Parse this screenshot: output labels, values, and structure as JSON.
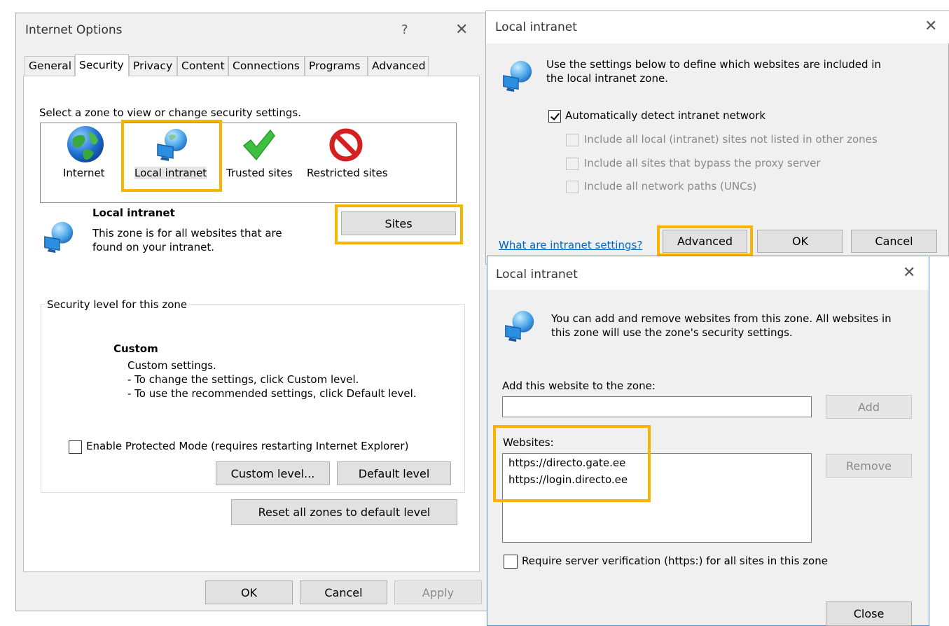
{
  "internet_options": {
    "title": "Internet Options",
    "help_glyph": "?",
    "close_glyph": "✕",
    "tabs": [
      "General",
      "Security",
      "Privacy",
      "Content",
      "Connections",
      "Programs",
      "Advanced"
    ],
    "active_tab": "Security",
    "zone_prompt": "Select a zone to view or change security settings.",
    "zones": [
      {
        "label": "Internet",
        "icon": "globe-icon"
      },
      {
        "label": "Local intranet",
        "icon": "intranet-icon",
        "selected": true
      },
      {
        "label": "Trusted sites",
        "icon": "checkmark-icon"
      },
      {
        "label": "Restricted sites",
        "icon": "restricted-icon"
      }
    ],
    "zone_title": "Local intranet",
    "zone_desc_line1": "This zone is for all websites that are",
    "zone_desc_line2": "found on your intranet.",
    "sites_button": "Sites",
    "security_group_label": "Security level for this zone",
    "level_title": "Custom",
    "level_line1": "Custom settings.",
    "level_line2": "- To change the settings, click Custom level.",
    "level_line3": "- To use the recommended settings, click Default level.",
    "protected_mode_label": "Enable Protected Mode (requires restarting Internet Explorer)",
    "custom_level_button": "Custom level...",
    "default_level_button": "Default level",
    "reset_all_button": "Reset all zones to default level",
    "ok_button": "OK",
    "cancel_button": "Cancel",
    "apply_button": "Apply"
  },
  "intranet_dialog": {
    "title": "Local intranet",
    "close_glyph": "✕",
    "description_line1": "Use the settings below to define which websites are included in",
    "description_line2": "the local intranet zone.",
    "auto_detect_label": "Automatically detect intranet network",
    "auto_detect_checked": true,
    "opt1_label": "Include all local (intranet) sites not listed in other zones",
    "opt2_label": "Include all sites that bypass the proxy server",
    "opt3_label": "Include all network paths (UNCs)",
    "help_link": "What are intranet settings?",
    "advanced_button": "Advanced",
    "ok_button": "OK",
    "cancel_button": "Cancel"
  },
  "sites_dialog": {
    "title": "Local intranet",
    "close_glyph": "✕",
    "description_line1": "You can add and remove websites from this zone. All websites in",
    "description_line2": "this zone will use the zone's security settings.",
    "add_label": "Add this website to the zone:",
    "add_input_value": "",
    "add_button": "Add",
    "websites_label": "Websites:",
    "websites": [
      "https://directo.gate.ee",
      "https://login.directo.ee"
    ],
    "remove_button": "Remove",
    "require_https_label": "Require server verification (https:) for all sites in this zone",
    "close_button": "Close"
  },
  "colors": {
    "highlight": "#f8b400",
    "link": "#0066cc",
    "dialog_background": "#f0f0f0"
  }
}
